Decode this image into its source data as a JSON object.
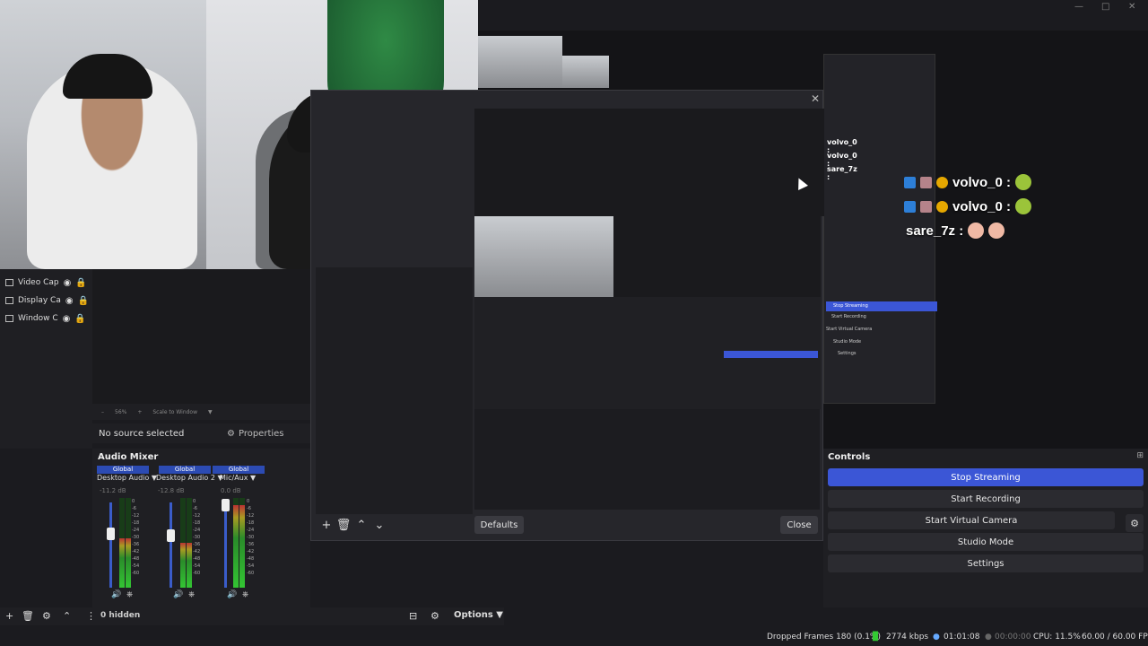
{
  "sources": [
    {
      "label": "Video Cap"
    },
    {
      "label": "Display Ca"
    },
    {
      "label": "Window C"
    }
  ],
  "preview_zoom": {
    "percent": "56%",
    "scale_mode": "Scale to Window"
  },
  "source_bar": {
    "no_source": "No source selected",
    "properties": "Properties"
  },
  "mixer": {
    "title": "Audio Mixer",
    "channels": [
      {
        "tag": "Global",
        "name": "Desktop Audio",
        "db": "-11.2 dB",
        "level": 0.55
      },
      {
        "tag": "Global",
        "name": "Desktop Audio 2",
        "db": "-12.8 dB",
        "level": 0.5
      },
      {
        "tag": "Global",
        "name": "Mic/Aux",
        "db": "0.0 dB",
        "level": 0.92
      }
    ],
    "scale_ticks": [
      "0",
      "-6",
      "-12",
      "-18",
      "-24",
      "-30",
      "-36",
      "-42",
      "-48",
      "-54",
      "-60"
    ]
  },
  "scene_toolbar": {
    "hidden_count": "0 hidden",
    "options_label": "Options"
  },
  "dialog": {
    "defaults_label": "Defaults",
    "close_label": "Close"
  },
  "controls": {
    "title": "Controls",
    "stop_streaming": "Stop Streaming",
    "start_recording": "Start Recording",
    "start_virtual_camera": "Start Virtual Camera",
    "studio_mode": "Studio Mode",
    "settings": "Settings"
  },
  "chat": [
    {
      "user": "volvo_0 :"
    },
    {
      "user": "volvo_0 :"
    },
    {
      "user": "sare_7z :"
    }
  ],
  "nested_controls": [
    "Stop Streaming",
    "Start Recording",
    "Start Virtual Camera",
    "Studio Mode",
    "Settings"
  ],
  "status": {
    "dropped_frames": "Dropped Frames 180 (0.1%)",
    "bitrate": "2774 kbps",
    "stream_time": "01:01:08",
    "record_time": "00:00:00",
    "cpu": "CPU: 11.5%",
    "fps": "60.00 / 60.00 FPS"
  },
  "colors": {
    "accent": "#3b56d6",
    "panel": "#1f1f23",
    "background": "#1b1b1f"
  }
}
